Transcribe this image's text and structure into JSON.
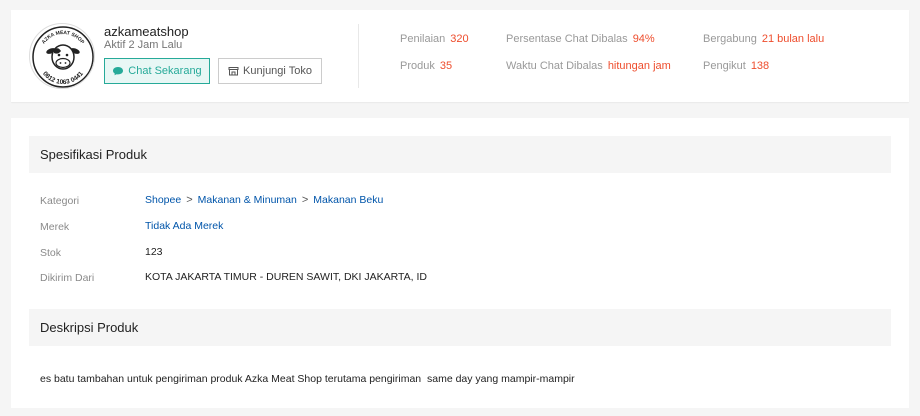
{
  "shop": {
    "logo_text_top": "AZKA MEAT SHOP",
    "logo_text_bottom": "0812 1063 0441",
    "name": "azkameatshop",
    "active_status": "Aktif 2 Jam Lalu",
    "chat_button": "Chat Sekarang",
    "visit_button": "Kunjungi Toko",
    "stats": {
      "rating_label": "Penilaian",
      "rating_value": "320",
      "products_label": "Produk",
      "products_value": "35",
      "chat_pct_label": "Persentase Chat Dibalas",
      "chat_pct_value": "94%",
      "chat_time_label": "Waktu Chat Dibalas",
      "chat_time_value": "hitungan jam",
      "joined_label": "Bergabung",
      "joined_value": "21 bulan lalu",
      "followers_label": "Pengikut",
      "followers_value": "138"
    }
  },
  "specs": {
    "title": "Spesifikasi Produk",
    "category_label": "Kategori",
    "category_path": [
      "Shopee",
      "Makanan & Minuman",
      "Makanan Beku"
    ],
    "brand_label": "Merek",
    "brand_value": "Tidak Ada Merek",
    "stock_label": "Stok",
    "stock_value": "123",
    "ship_from_label": "Dikirim Dari",
    "ship_from_value": "KOTA JAKARTA TIMUR - DUREN SAWIT, DKI JAKARTA, ID"
  },
  "description": {
    "title": "Deskripsi Produk",
    "text": "es batu tambahan untuk pengiriman produk Azka Meat Shop terutama pengiriman  same day yang mampir-mampir"
  },
  "colors": {
    "accent": "#ee4d2d",
    "teal": "#26aa99",
    "link": "#0055aa"
  }
}
